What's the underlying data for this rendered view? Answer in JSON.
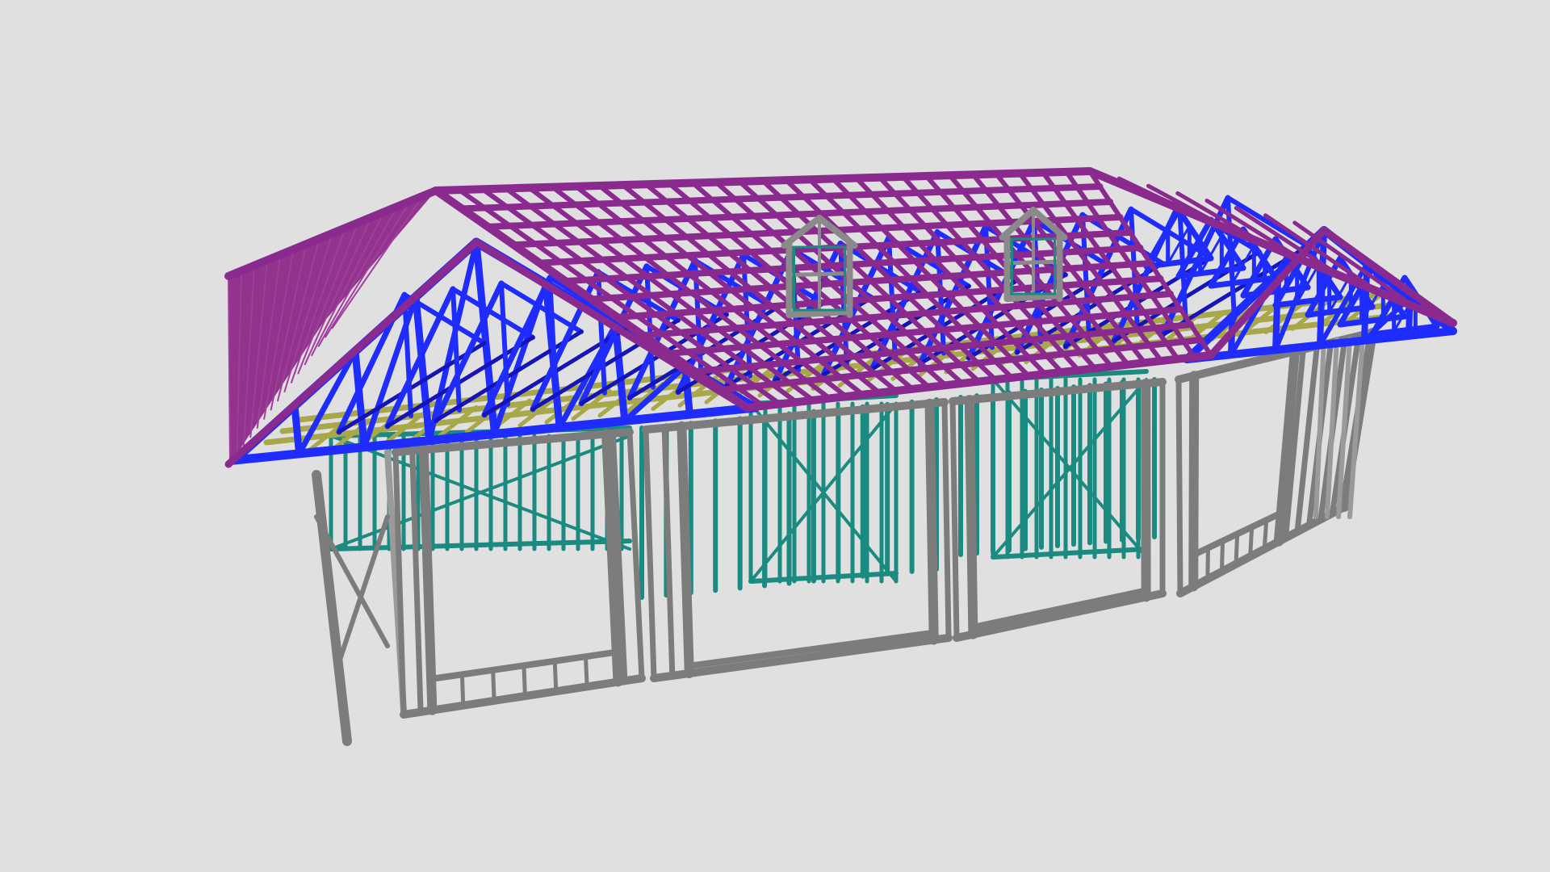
{
  "scene": {
    "background": "#e0e0e0",
    "subject": "steel-frame-house-model"
  },
  "colors": {
    "roof_purlins": "#8a2a8e",
    "roof_sheathing": "#8c2a86",
    "trusses": "#1f2cff",
    "truss_dark": "#1414b8",
    "top_plates": "#a8a84a",
    "front_walls": "#7c7c7c",
    "front_walls_light": "#9a9a9a",
    "interior_walls": "#1b8a80",
    "dormer_frame": "#8a8a8a"
  }
}
